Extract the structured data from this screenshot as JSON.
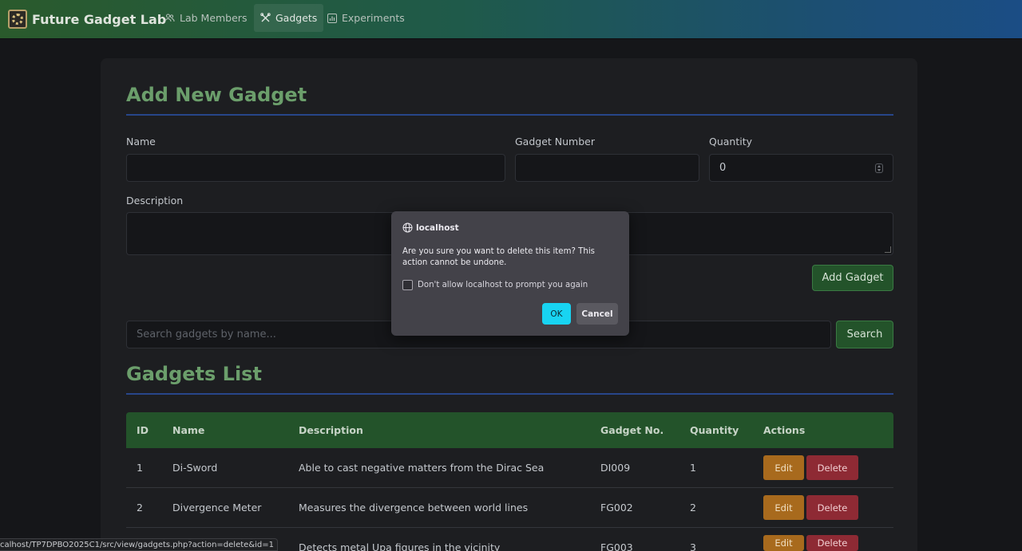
{
  "navbar": {
    "brand": "Future Gadget Lab",
    "items": [
      {
        "label": "Lab Members",
        "icon": "users-icon"
      },
      {
        "label": "Gadgets",
        "icon": "tools-icon",
        "active": true
      },
      {
        "label": "Experiments",
        "icon": "chart-icon"
      }
    ]
  },
  "form": {
    "title": "Add New Gadget",
    "name_label": "Name",
    "name_value": "",
    "number_label": "Gadget Number",
    "number_value": "",
    "quantity_label": "Quantity",
    "quantity_value": "0",
    "description_label": "Description",
    "submit_label": "Add Gadget"
  },
  "search": {
    "placeholder": "Search gadgets by name...",
    "button_label": "Search"
  },
  "list": {
    "title": "Gadgets List",
    "columns": [
      "ID",
      "Name",
      "Description",
      "Gadget No.",
      "Quantity",
      "Actions"
    ],
    "rows": [
      {
        "id": "1",
        "name": "Di-Sword",
        "description": "Able to cast negative matters from the Dirac Sea",
        "number": "DI009",
        "quantity": "1"
      },
      {
        "id": "2",
        "name": "Divergence Meter",
        "description": "Measures the divergence between world lines",
        "number": "FG002",
        "quantity": "2"
      },
      {
        "id": "3",
        "name": "",
        "description": "Detects metal Upa figures in the vicinity",
        "number": "FG003",
        "quantity": "3"
      }
    ],
    "edit_label": "Edit",
    "delete_label": "Delete"
  },
  "dialog": {
    "origin": "localhost",
    "message": "Are you sure you want to delete this item? This action cannot be undone.",
    "checkbox_label": "Don't allow localhost to prompt you again",
    "ok_label": "OK",
    "cancel_label": "Cancel"
  },
  "status_url": "calhost/TP7DPBO2025C1/src/view/gadgets.php?action=delete&id=1",
  "colors": {
    "accent_green": "#23532a",
    "title_green": "#6b9e6b",
    "ok_cyan": "#18d4f2",
    "edit_orange": "#a86a1d",
    "delete_red": "#8e2a34"
  }
}
